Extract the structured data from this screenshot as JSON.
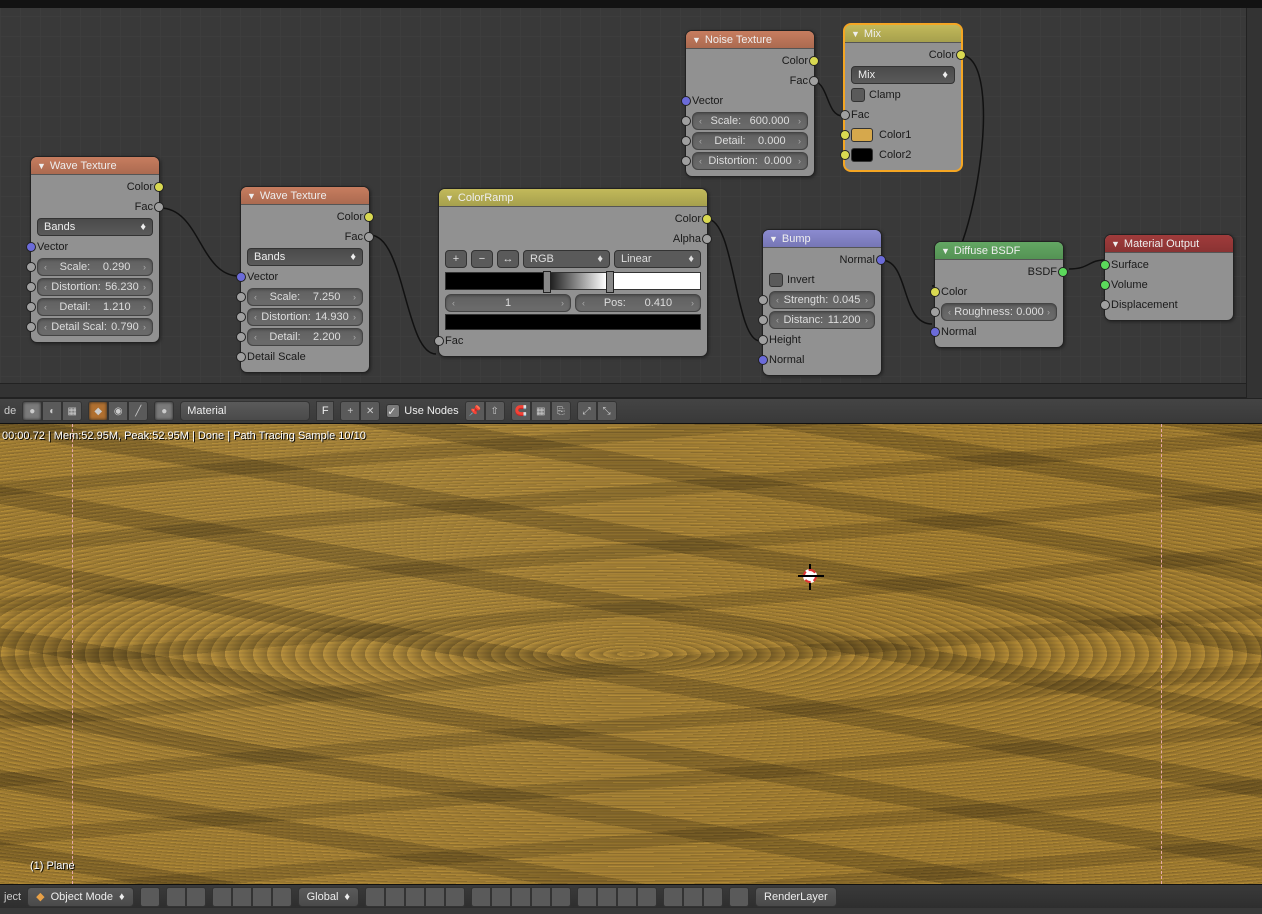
{
  "nodes": {
    "wave1": {
      "title": "Wave Texture",
      "out_color": "Color",
      "out_fac": "Fac",
      "type": "Bands",
      "vector": "Vector",
      "scale_lbl": "Scale:",
      "scale_val": "0.290",
      "dist_lbl": "Distortion:",
      "dist_val": "56.230",
      "det_lbl": "Detail:",
      "det_val": "1.210",
      "dscl_lbl": "Detail Scal:",
      "dscl_val": "0.790"
    },
    "wave2": {
      "title": "Wave Texture",
      "out_color": "Color",
      "out_fac": "Fac",
      "type": "Bands",
      "vector": "Vector",
      "scale_lbl": "Scale:",
      "scale_val": "7.250",
      "dist_lbl": "Distortion:",
      "dist_val": "14.930",
      "det_lbl": "Detail:",
      "det_val": "2.200",
      "dscl_lbl": "Detail Scale"
    },
    "colorramp": {
      "title": "ColorRamp",
      "out_color": "Color",
      "out_alpha": "Alpha",
      "mode": "RGB",
      "interp": "Linear",
      "idx": "1",
      "pos_lbl": "Pos:",
      "pos_val": "0.410",
      "fac": "Fac",
      "plus": "+",
      "minus": "−",
      "flip": "↔"
    },
    "noise": {
      "title": "Noise Texture",
      "out_color": "Color",
      "out_fac": "Fac",
      "vector": "Vector",
      "scale_lbl": "Scale:",
      "scale_val": "600.000",
      "det_lbl": "Detail:",
      "det_val": "0.000",
      "dist_lbl": "Distortion:",
      "dist_val": "0.000"
    },
    "mix": {
      "title": "Mix",
      "out_color": "Color",
      "blend": "Mix",
      "clamp": "Clamp",
      "fac": "Fac",
      "color1": "Color1",
      "color2": "Color2",
      "swatch1": "#d6a84c",
      "swatch2": "#000000"
    },
    "bump": {
      "title": "Bump",
      "out_normal": "Normal",
      "invert": "Invert",
      "str_lbl": "Strength:",
      "str_val": "0.045",
      "dist_lbl": "Distanc:",
      "dist_val": "11.200",
      "height": "Height",
      "normal": "Normal"
    },
    "diffuse": {
      "title": "Diffuse BSDF",
      "out_bsdf": "BSDF",
      "color": "Color",
      "rough_lbl": "Roughness:",
      "rough_val": "0.000",
      "normal": "Normal"
    },
    "matout": {
      "title": "Material Output",
      "surface": "Surface",
      "volume": "Volume",
      "displacement": "Displacement"
    }
  },
  "toolbar": {
    "mode_prefix": "de",
    "material_name": "Material",
    "f_label": "F",
    "use_nodes": "Use Nodes"
  },
  "render": {
    "status": "00:00.72 | Mem:52.95M, Peak:52.95M | Done | Path Tracing Sample 10/10",
    "object_name": "(1) Plane"
  },
  "footer": {
    "prefix": "ject",
    "mode": "Object Mode",
    "orientation": "Global",
    "renderlayer": "RenderLayer"
  }
}
